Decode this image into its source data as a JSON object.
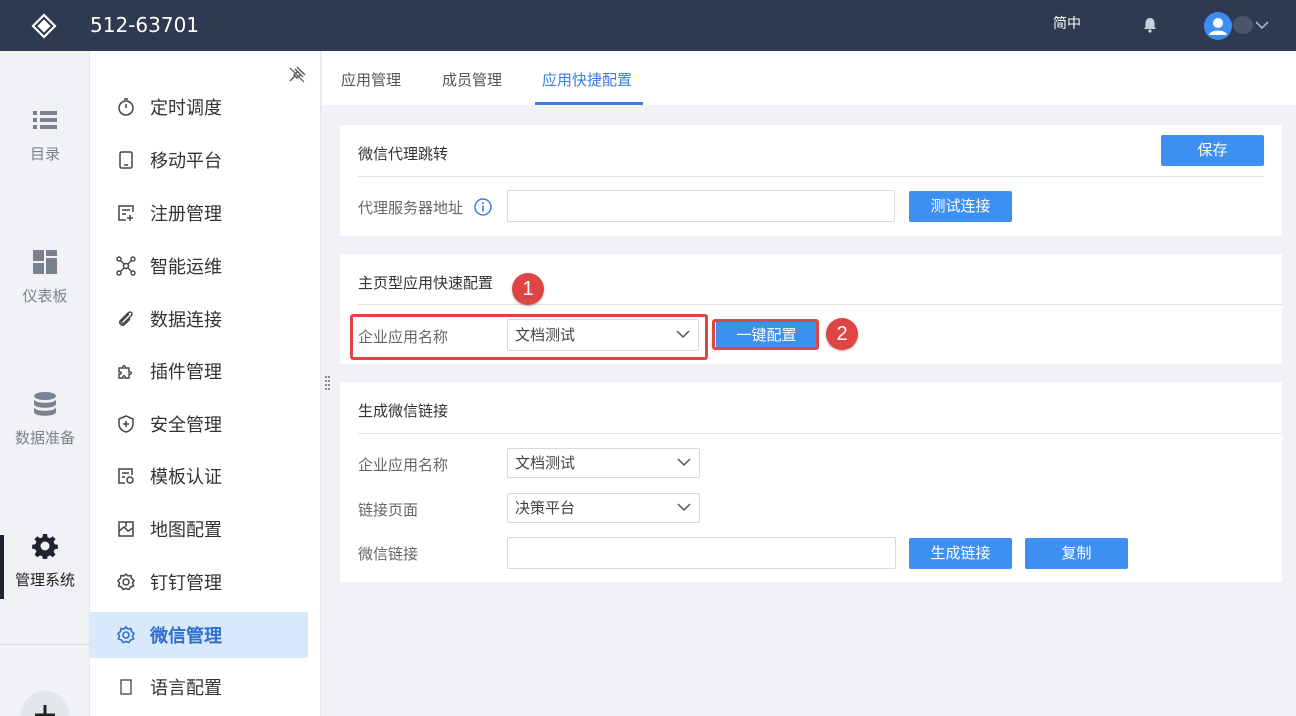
{
  "header": {
    "app_title": "512-63701",
    "lang": "简中"
  },
  "rail": {
    "items": [
      {
        "label": "目录",
        "icon": "list-icon"
      },
      {
        "label": "仪表板",
        "icon": "dashboard-icon"
      },
      {
        "label": "数据准备",
        "icon": "database-icon"
      },
      {
        "label": "管理系统",
        "icon": "gear-icon"
      }
    ],
    "active_index": 3
  },
  "subnav": {
    "items": [
      {
        "label": "定时调度",
        "icon": "timer-icon"
      },
      {
        "label": "移动平台",
        "icon": "mobile-icon"
      },
      {
        "label": "注册管理",
        "icon": "register-icon"
      },
      {
        "label": "智能运维",
        "icon": "network-icon"
      },
      {
        "label": "数据连接",
        "icon": "paperclip-icon"
      },
      {
        "label": "插件管理",
        "icon": "puzzle-icon"
      },
      {
        "label": "安全管理",
        "icon": "shield-icon"
      },
      {
        "label": "模板认证",
        "icon": "template-icon"
      },
      {
        "label": "地图配置",
        "icon": "map-icon"
      },
      {
        "label": "钉钉管理",
        "icon": "gear-icon"
      },
      {
        "label": "微信管理",
        "icon": "gear-icon"
      },
      {
        "label": "语言配置",
        "icon": "language-icon"
      }
    ],
    "active_index": 10
  },
  "tabs": [
    {
      "label": "应用管理"
    },
    {
      "label": "成员管理"
    },
    {
      "label": "应用快捷配置"
    }
  ],
  "active_tab": 2,
  "proxy_panel": {
    "title": "微信代理跳转",
    "save_label": "保存",
    "server_label": "代理服务器地址",
    "server_value": "",
    "test_label": "测试连接"
  },
  "quick_panel": {
    "title": "主页型应用快速配置",
    "app_name_label": "企业应用名称",
    "app_name_value": "文档测试",
    "one_click_label": "一键配置",
    "badge_1": "1",
    "badge_2": "2"
  },
  "link_panel": {
    "title": "生成微信链接",
    "app_name_label": "企业应用名称",
    "app_name_value": "文档测试",
    "page_label": "链接页面",
    "page_value": "决策平台",
    "link_label": "微信链接",
    "link_value": "",
    "generate_label": "生成链接",
    "copy_label": "复制"
  },
  "colors": {
    "topbar": "#2d3a4f",
    "accent": "#3d8ff0",
    "highlight": "#e04545",
    "nav_active_bg": "#dae8fb"
  }
}
